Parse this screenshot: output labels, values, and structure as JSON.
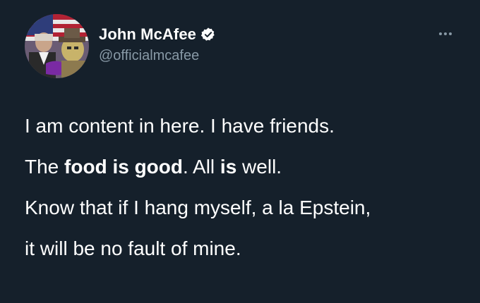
{
  "user": {
    "display_name": "John McAfee",
    "handle": "@officialmcafee",
    "verified": true
  },
  "menu": {
    "icon": "more-horizontal-icon"
  },
  "tweet": {
    "line1": "I am content in here. I have friends.",
    "line2": {
      "part1": "The ",
      "bold1": "food is good",
      "part2": ". All ",
      "bold2": "is",
      "part3": " well."
    },
    "line3": "Know that if I hang myself, a la Epstein,",
    "line4": "it will be no fault of mine."
  },
  "colors": {
    "background": "#15202b",
    "text": "#ffffff",
    "muted": "#8899a6",
    "verified": "#ffffff"
  }
}
